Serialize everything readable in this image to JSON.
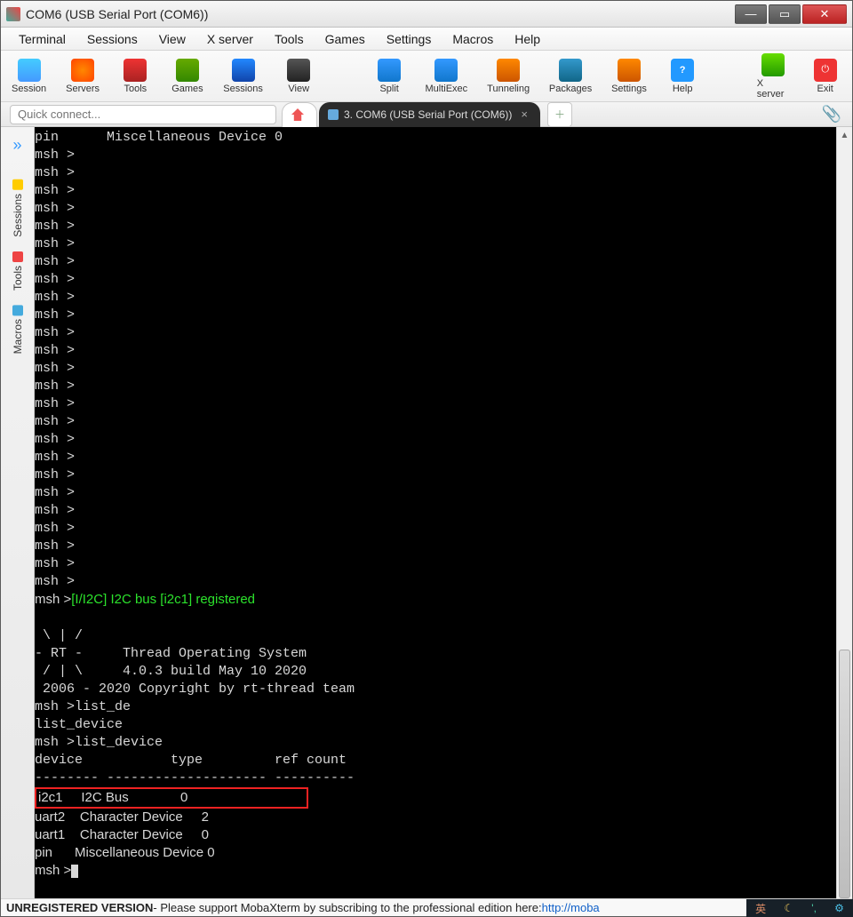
{
  "window": {
    "title": "COM6  (USB Serial Port (COM6))"
  },
  "menu": [
    "Terminal",
    "Sessions",
    "View",
    "X server",
    "Tools",
    "Games",
    "Settings",
    "Macros",
    "Help"
  ],
  "toolbar": [
    {
      "name": "session",
      "label": "Session"
    },
    {
      "name": "servers",
      "label": "Servers"
    },
    {
      "name": "tools",
      "label": "Tools"
    },
    {
      "name": "games",
      "label": "Games"
    },
    {
      "name": "sessions",
      "label": "Sessions"
    },
    {
      "name": "view",
      "label": "View"
    },
    {
      "name": "split",
      "label": "Split"
    },
    {
      "name": "multiexec",
      "label": "MultiExec"
    },
    {
      "name": "tunneling",
      "label": "Tunneling"
    },
    {
      "name": "packages",
      "label": "Packages"
    },
    {
      "name": "settings",
      "label": "Settings"
    },
    {
      "name": "help",
      "label": "Help"
    },
    {
      "name": "xserver",
      "label": "X server"
    },
    {
      "name": "exit",
      "label": "Exit"
    }
  ],
  "quick_placeholder": "Quick connect...",
  "tabs": {
    "active": "3. COM6  (USB Serial Port (COM6))"
  },
  "side_tabs": [
    "Sessions",
    "Tools",
    "Macros"
  ],
  "terminal": {
    "top_line": "pin      Miscellaneous Device 0",
    "prompt": "msh >",
    "i2c_msg": "[I/I2C] I2C bus [i2c1] registered",
    "banner": [
      " \\ | /",
      "- RT -     Thread Operating System",
      " / | \\     4.0.3 build May 10 2020",
      " 2006 - 2020 Copyright by rt-thread team"
    ],
    "cmd1": "msh >list_de",
    "cmd1_comp": "list_device",
    "cmd2": "msh >list_device",
    "table_header": "device           type         ref count",
    "table_sep": "-------- -------------------- ----------",
    "rows": [
      {
        "dev": "i2c1",
        "type": "I2C Bus",
        "ref": "0",
        "hl": true
      },
      {
        "dev": "uart2",
        "type": "Character Device",
        "ref": "2"
      },
      {
        "dev": "uart1",
        "type": "Character Device",
        "ref": "0"
      },
      {
        "dev": "pin",
        "type": "Miscellaneous Device",
        "ref": "0"
      }
    ]
  },
  "footer": {
    "bold": "UNREGISTERED VERSION",
    "text": "  -  Please support MobaXterm by subscribing to the professional edition here:  ",
    "link": "http://moba"
  },
  "tray": {
    "lang": "英"
  }
}
